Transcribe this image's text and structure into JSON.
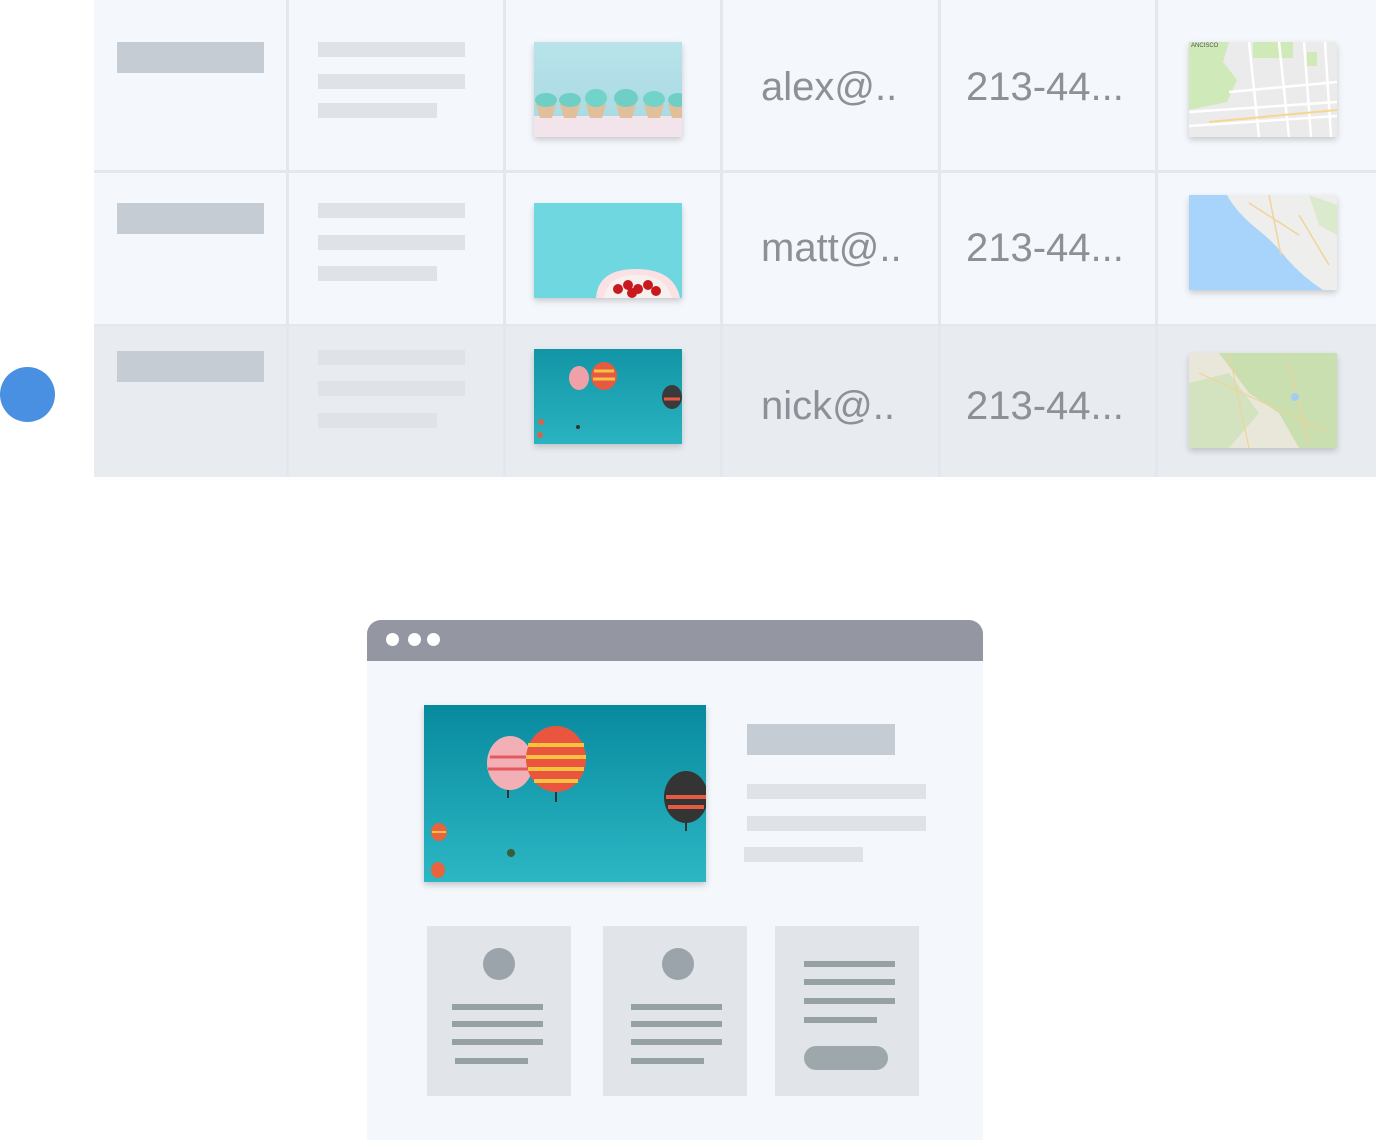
{
  "table": {
    "rows": [
      {
        "email": "alex@..",
        "phone": "213-44...",
        "image": "cupcakes-photo",
        "map": "san-francisco-map",
        "map_label": "ANCISCO"
      },
      {
        "email": "matt@..",
        "phone": "213-44...",
        "image": "strawberries-photo",
        "map": "coastline-map"
      },
      {
        "email": "nick@..",
        "phone": "213-44...",
        "image": "balloons-photo",
        "map": "terrain-map"
      }
    ],
    "selected_row": 3
  },
  "colors": {
    "selector_dot": "#4a90e2",
    "row_bg": "#f4f7fb",
    "selected_row_bg": "#e8ecf1",
    "browser_titlebar": "#9497a2",
    "text": "#8d9096"
  },
  "browser": {
    "hero_image": "balloons-photo",
    "cards": [
      {
        "type": "profile-card"
      },
      {
        "type": "profile-card"
      },
      {
        "type": "text-card-with-button"
      }
    ]
  }
}
